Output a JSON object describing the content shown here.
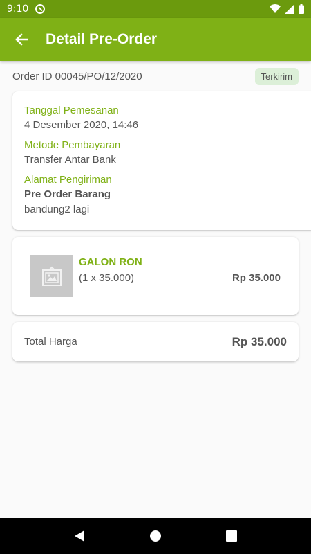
{
  "status_bar": {
    "time": "9:10"
  },
  "app_bar": {
    "title": "Detail Pre-Order"
  },
  "order": {
    "id_text": "Order ID 00045/PO/12/2020",
    "status": "Terkirim"
  },
  "info": {
    "date_label": "Tanggal Pemesanan",
    "date_value": "4 Desember 2020, 14:46",
    "payment_label": "Metode Pembayaran",
    "payment_value": "Transfer Antar Bank",
    "address_label": "Alamat Pengiriman",
    "address_title": "Pre Order Barang",
    "address_detail": "bandung2 lagi"
  },
  "item": {
    "name": "GALON RON",
    "qty": "(1 x 35.000)",
    "price": "Rp 35.000"
  },
  "total": {
    "label": "Total Harga",
    "value": "Rp 35.000"
  },
  "colors": {
    "primary": "#7fb116",
    "status_bar": "#6b9a0d",
    "badge_bg": "#dcefd8"
  },
  "icons": {
    "back": "arrow-back-icon",
    "image_placeholder": "image-placeholder-icon",
    "nav_back": "triangle-back-icon",
    "nav_home": "circle-home-icon",
    "nav_recents": "square-recents-icon"
  }
}
